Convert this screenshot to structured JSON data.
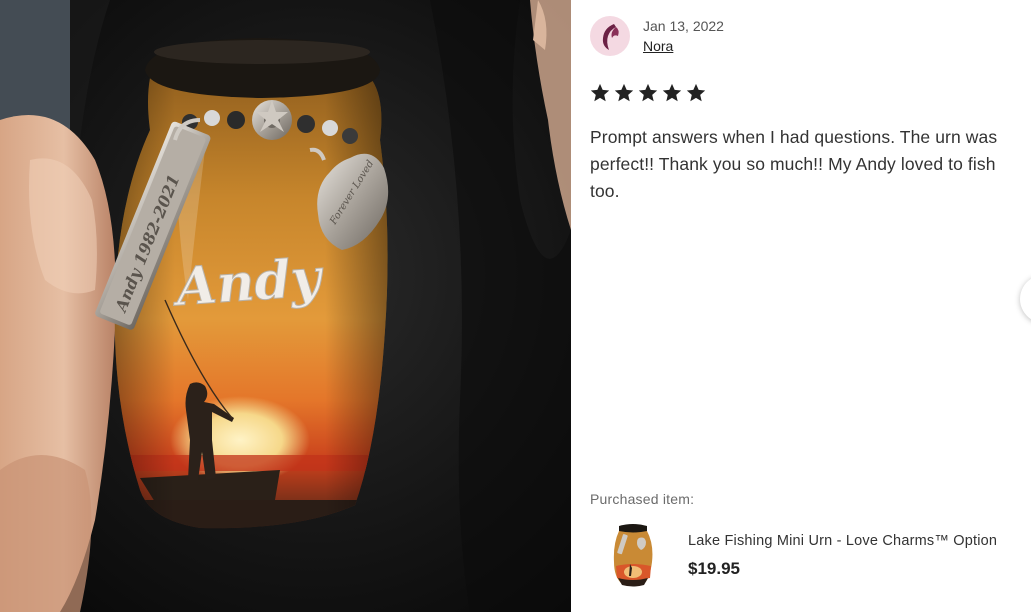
{
  "photo": {
    "urn_name": "Andy",
    "tag_engraving": "Andy 1982-2021",
    "heart_engraving": "Forever Loved"
  },
  "review": {
    "date": "Jan 13, 2022",
    "author": "Nora",
    "rating": 5,
    "rating_max": 5,
    "text": "Prompt answers when I had questions. The urn was perfect!! Thank you so much!! My Andy loved to fish too.",
    "star_color": "#222222"
  },
  "purchased": {
    "label": "Purchased item:",
    "title": "Lake Fishing Mini Urn - Love Charms™ Option",
    "price": "$19.95"
  },
  "icons": {
    "avatar": "user-avatar-icon",
    "star": "star-icon",
    "next": "carousel-next-icon"
  }
}
